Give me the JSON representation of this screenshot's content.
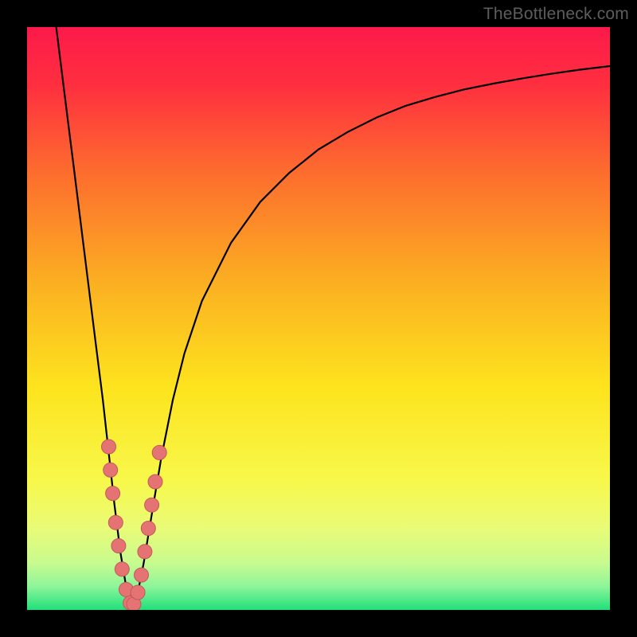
{
  "watermark": "TheBottleneck.com",
  "colors": {
    "frame": "#000000",
    "watermark": "#5d5d5d",
    "curve": "#000000",
    "dot_fill": "#e57373",
    "dot_stroke": "#c05a5a",
    "gradient_stops": [
      {
        "offset": 0.0,
        "color": "#fd1a4a"
      },
      {
        "offset": 0.1,
        "color": "#fe2f3f"
      },
      {
        "offset": 0.25,
        "color": "#fd6d2e"
      },
      {
        "offset": 0.45,
        "color": "#fbb321"
      },
      {
        "offset": 0.62,
        "color": "#fde41e"
      },
      {
        "offset": 0.78,
        "color": "#f7f84b"
      },
      {
        "offset": 0.86,
        "color": "#e9fb77"
      },
      {
        "offset": 0.92,
        "color": "#c7fb8f"
      },
      {
        "offset": 0.96,
        "color": "#8df59a"
      },
      {
        "offset": 1.0,
        "color": "#20e07a"
      }
    ]
  },
  "chart_data": {
    "type": "line",
    "title": "",
    "xlabel": "",
    "ylabel": "",
    "xlim": [
      0,
      100
    ],
    "ylim": [
      0,
      100
    ],
    "notch_x": 18,
    "series": [
      {
        "name": "bottleneck-curve",
        "x": [
          5,
          6,
          7,
          8,
          9,
          10,
          11,
          12,
          13,
          14,
          15,
          16,
          17,
          18,
          19,
          20,
          21,
          22,
          23,
          24,
          25,
          27,
          30,
          35,
          40,
          45,
          50,
          55,
          60,
          65,
          70,
          75,
          80,
          85,
          90,
          95,
          100
        ],
        "y": [
          100,
          92,
          84,
          76,
          68,
          60,
          52,
          44,
          36,
          27,
          18,
          10,
          4,
          0,
          3,
          8,
          14,
          20,
          26,
          31,
          36,
          44,
          53,
          63,
          70,
          75,
          79,
          82,
          84.5,
          86.5,
          88,
          89.3,
          90.3,
          91.2,
          92,
          92.7,
          93.3
        ]
      }
    ],
    "dots": [
      {
        "x": 14.0,
        "y": 28
      },
      {
        "x": 14.3,
        "y": 24
      },
      {
        "x": 14.7,
        "y": 20
      },
      {
        "x": 15.2,
        "y": 15
      },
      {
        "x": 15.7,
        "y": 11
      },
      {
        "x": 16.3,
        "y": 7
      },
      {
        "x": 17.0,
        "y": 3.5
      },
      {
        "x": 17.7,
        "y": 1.2
      },
      {
        "x": 18.3,
        "y": 1.0
      },
      {
        "x": 19.0,
        "y": 3.0
      },
      {
        "x": 19.6,
        "y": 6.0
      },
      {
        "x": 20.2,
        "y": 10
      },
      {
        "x": 20.8,
        "y": 14
      },
      {
        "x": 21.4,
        "y": 18
      },
      {
        "x": 22.0,
        "y": 22
      },
      {
        "x": 22.7,
        "y": 27
      }
    ]
  }
}
